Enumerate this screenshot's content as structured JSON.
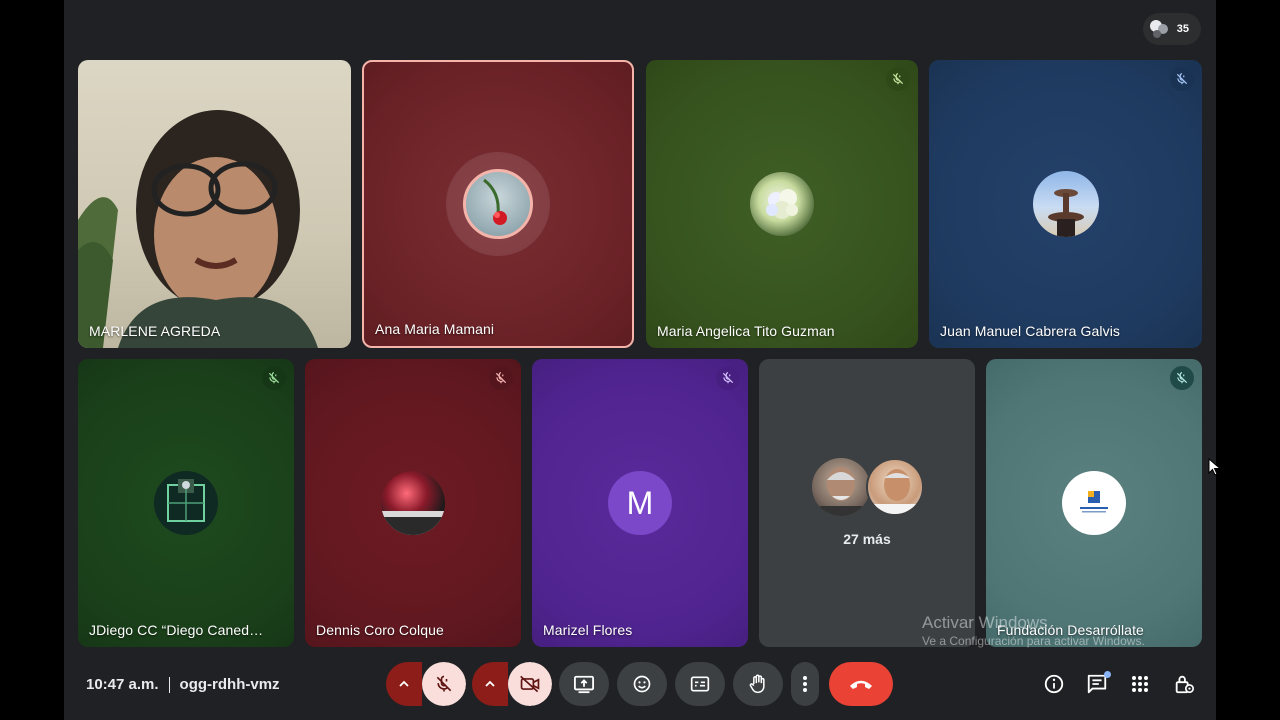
{
  "participant_count": "35",
  "participants": [
    {
      "name": "MARLENE AGREDA"
    },
    {
      "name": "Ana Maria Mamani"
    },
    {
      "name": "Maria Angelica Tito Guzman"
    },
    {
      "name": "Juan Manuel Cabrera Galvis"
    },
    {
      "name": "JDiego CC “Diego Caned…"
    },
    {
      "name": "Dennis Coro Colque"
    },
    {
      "name": "Marizel Flores",
      "initial": "M"
    },
    {
      "more_label": "27 más"
    },
    {
      "name": "Fundación Desarróllate"
    }
  ],
  "bottom_bar": {
    "time": "10:47 a.m.",
    "meeting_code": "ogg-rdhh-vmz"
  },
  "watermark": {
    "line1": "Activar Windows",
    "line2": "Ve a Configuración para activar Windows."
  },
  "colors": {
    "stage_bg": "#202124",
    "end_call": "#ea4335",
    "mic_off_tint": "#f9dedc",
    "speaking_border": "#f4b4aa"
  },
  "icons": [
    "people-icon",
    "mic-off-icon",
    "chevron-up-icon",
    "camera-off-icon",
    "present-icon",
    "emoji-icon",
    "captions-icon",
    "raise-hand-icon",
    "more-options-icon",
    "end-call-icon",
    "info-icon",
    "chat-icon",
    "activities-icon",
    "host-controls-icon"
  ]
}
